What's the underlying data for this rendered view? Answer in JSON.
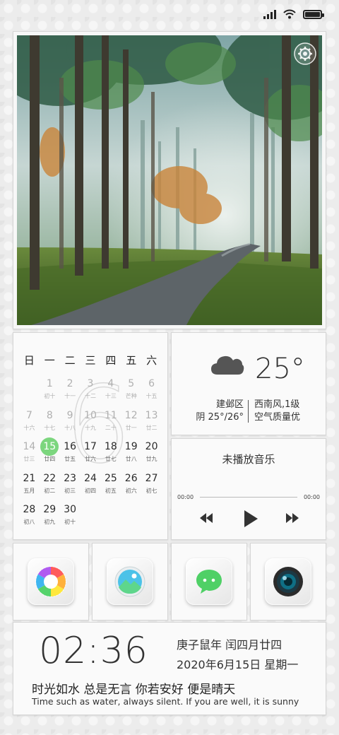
{
  "status_bar": {
    "signal": "signal-icon",
    "wifi": "wifi-icon",
    "battery_level": 1.0
  },
  "photo": {
    "subject": "forest-road-photo",
    "settings_icon": "gear-icon"
  },
  "calendar": {
    "month_watermark": "6",
    "weekdays": [
      "日",
      "一",
      "二",
      "三",
      "四",
      "五",
      "六"
    ],
    "leading_blanks": 1,
    "today": 15,
    "days": [
      {
        "d": "1",
        "l": "初十"
      },
      {
        "d": "2",
        "l": "十一"
      },
      {
        "d": "3",
        "l": "十二"
      },
      {
        "d": "4",
        "l": "十三"
      },
      {
        "d": "5",
        "l": "芒种"
      },
      {
        "d": "6",
        "l": "十五"
      },
      {
        "d": "7",
        "l": "十六"
      },
      {
        "d": "8",
        "l": "十七"
      },
      {
        "d": "9",
        "l": "十八"
      },
      {
        "d": "10",
        "l": "十九"
      },
      {
        "d": "11",
        "l": "二十"
      },
      {
        "d": "12",
        "l": "廿一"
      },
      {
        "d": "13",
        "l": "廿二"
      },
      {
        "d": "14",
        "l": "廿三"
      },
      {
        "d": "15",
        "l": "廿四"
      },
      {
        "d": "16",
        "l": "廿五"
      },
      {
        "d": "17",
        "l": "廿六"
      },
      {
        "d": "18",
        "l": "廿七"
      },
      {
        "d": "19",
        "l": "廿八"
      },
      {
        "d": "20",
        "l": "廿九"
      },
      {
        "d": "21",
        "l": "五月"
      },
      {
        "d": "22",
        "l": "初二"
      },
      {
        "d": "23",
        "l": "初三"
      },
      {
        "d": "24",
        "l": "初四"
      },
      {
        "d": "25",
        "l": "初五"
      },
      {
        "d": "26",
        "l": "初六"
      },
      {
        "d": "27",
        "l": "初七"
      },
      {
        "d": "28",
        "l": "初八"
      },
      {
        "d": "29",
        "l": "初九"
      },
      {
        "d": "30",
        "l": "初十"
      }
    ]
  },
  "weather": {
    "icon": "cloud-icon",
    "temp": "25°",
    "district": "建邺区",
    "range": "阴 25°/26°",
    "wind": "西南风,1级",
    "air": "空气质量优"
  },
  "music": {
    "title": "未播放音乐",
    "elapsed": "00:00",
    "duration": "00:00",
    "progress": 0
  },
  "apps": [
    {
      "name": "theme-app-icon"
    },
    {
      "name": "gallery-app-icon"
    },
    {
      "name": "messages-app-icon"
    },
    {
      "name": "camera-app-icon"
    }
  ],
  "clock": {
    "time": "02:36",
    "lunar": "庚子鼠年 闰四月廿四",
    "date": "2020年6月15日 星期一",
    "quote_zh": "时光如水 总是无言 你若安好 便是晴天",
    "quote_en": "Time such as water, always silent. If you are well, it is sunny"
  },
  "colors": {
    "today_highlight": "#7cd67e",
    "card_bg": "#fafafa",
    "page_bg": "#ececec"
  }
}
